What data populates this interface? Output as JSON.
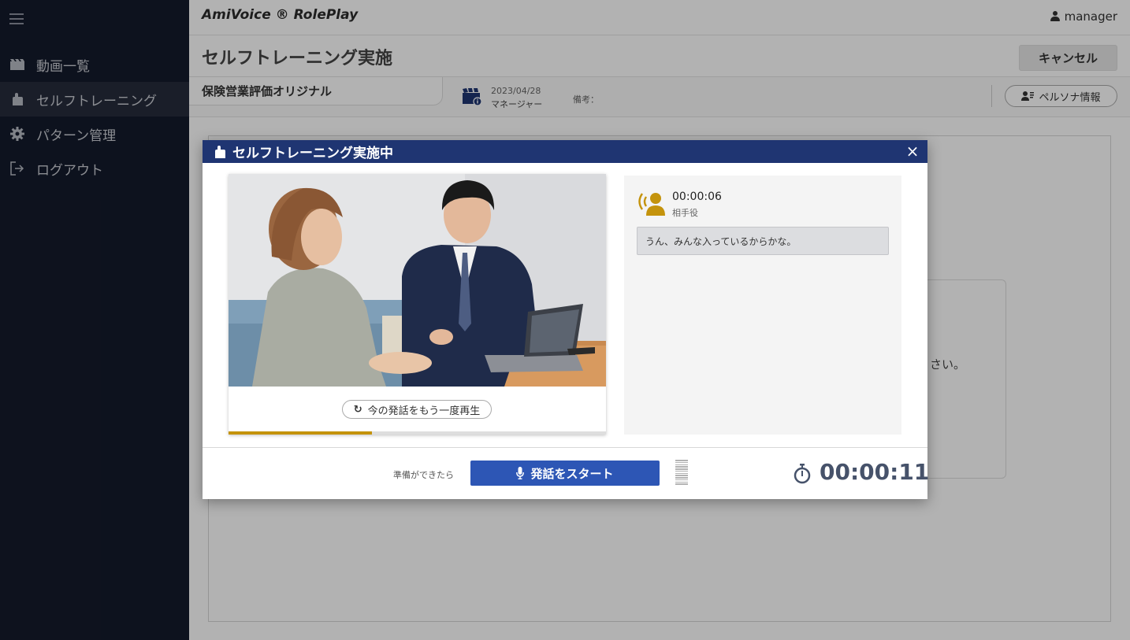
{
  "app": {
    "brand": "AmiVoice ® RolePlay",
    "user": "manager"
  },
  "sidebar": {
    "items": [
      {
        "label": "動画一覧",
        "icon": "film-icon",
        "active": false
      },
      {
        "label": "セルフトレーニング",
        "icon": "hand-icon",
        "active": true
      },
      {
        "label": "パターン管理",
        "icon": "gear-icon",
        "active": false
      },
      {
        "label": "ログアウト",
        "icon": "logout-icon",
        "active": false
      }
    ]
  },
  "page": {
    "title": "セルフトレーニング実施",
    "cancel_label": "キャンセル",
    "course_name": "保険営業評価オリジナル",
    "meta_date": "2023/04/28",
    "meta_role": "マネージャー",
    "note_label": "備考：",
    "persona_label": "ペルソナ情報",
    "bg_card_mark": "i",
    "bg_card_text": "さい。"
  },
  "modal": {
    "title": "セルフトレーニング実施中",
    "close_label": "×",
    "replay_label": "今の発話をもう一度再生",
    "video_progress": 0.38,
    "speaker_time": "00:00:06",
    "speaker_role": "相手役",
    "utterance": "うん、みんな入っているからかな。",
    "ready_text": "準備ができたら",
    "start_label": "発話をスタート",
    "elapsed": "00:00:11"
  },
  "colors": {
    "sidebar_bg": "#141a2b",
    "modal_header": "#1f3572",
    "start_button": "#2d56b5",
    "accent_gold": "#c4930c",
    "timer_text": "#46526a"
  }
}
